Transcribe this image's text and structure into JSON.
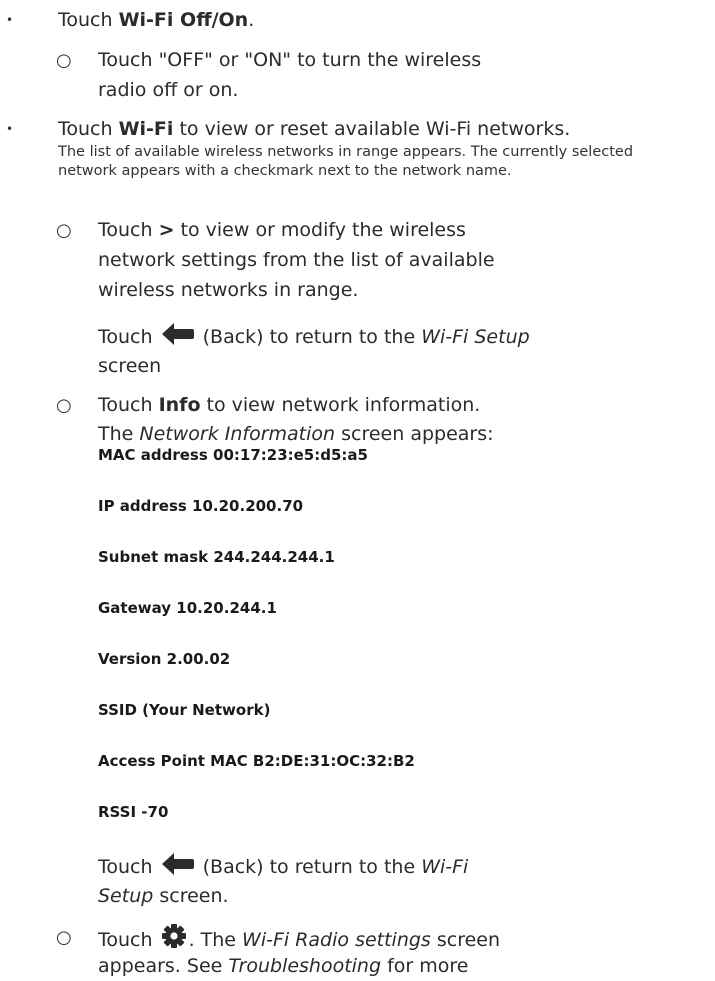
{
  "bullet_mark": "•",
  "sub_mark": "○",
  "b1": {
    "pre": "Touch ",
    "bold": "Wi-Fi Off/On",
    "post": "."
  },
  "b1a": {
    "line1": "Touch \"OFF\" or \"ON\" to turn the wireless",
    "line2": "radio off or on."
  },
  "b2": {
    "pre": "Touch ",
    "bold": "Wi-Fi",
    "post": " to view or reset available Wi-Fi networks.",
    "note1": "The list of available wireless networks in range appears. The currently selected",
    "note2": "network appears with a checkmark next to the network name."
  },
  "b2a": {
    "pre": "Touch ",
    "bold": ">",
    "post": " to view or modify the wireless",
    "line2": "network settings from the list of available",
    "line3": "wireless networks in range.",
    "back_pre": "Touch ",
    "back_post": " (Back) to return to the ",
    "back_screen": "Wi-Fi Setup",
    "back_line2": "screen"
  },
  "b2b": {
    "pre": "Touch ",
    "bold": "Info",
    "post": " to view network information.",
    "l2_pre": "The ",
    "l2_it": "Network Information",
    "l2_post": " screen appears:",
    "info": [
      "MAC address 00:17:23:e5:d5:a5",
      "IP address 10.20.200.70",
      "Subnet mask 244.244.244.1",
      "Gateway 10.20.244.1",
      "Version 2.00.02",
      "SSID (Your Network)",
      "Access Point MAC B2:DE:31:OC:32:B2",
      "RSSI -70"
    ],
    "back_pre": "Touch ",
    "back_post": " (Back) to return to the ",
    "back_it1": "Wi-Fi",
    "back_it2": "Setup",
    "back_end": " screen."
  },
  "b2c": {
    "pre": "Touch ",
    "post": ". The ",
    "it": "Wi-Fi Radio settings",
    "post2": " screen",
    "line2_pre": "appears. See ",
    "line2_it": "Troubleshooting",
    "line2_post": " for more"
  },
  "icons": {
    "back": "back-arrow-icon",
    "settings": "gear-icon"
  }
}
